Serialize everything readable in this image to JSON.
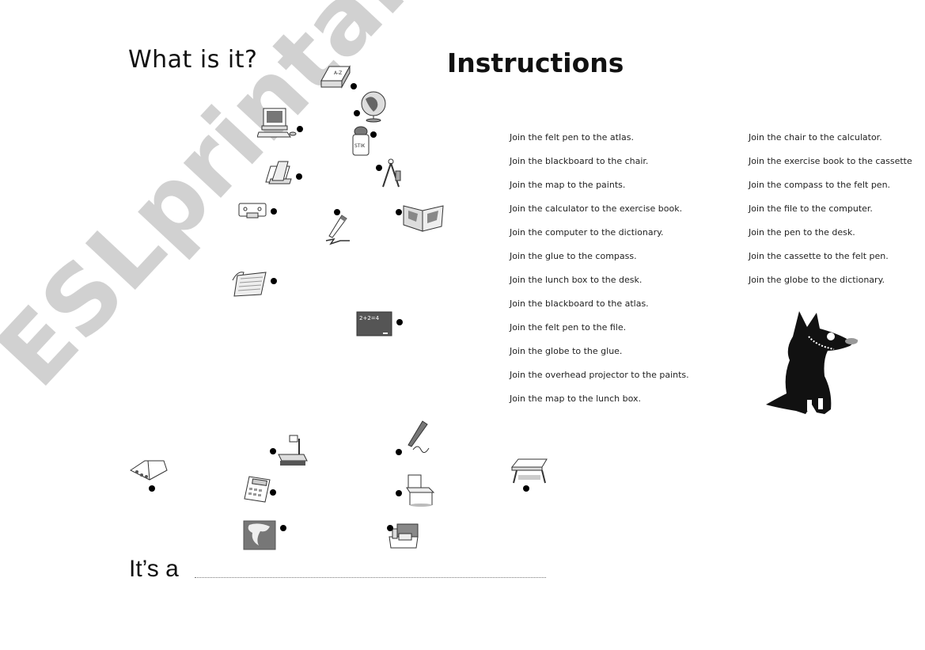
{
  "header": {
    "question_title": "What is it?",
    "instructions_title": "Instructions"
  },
  "instructions": {
    "column1": [
      "Join the felt pen to the atlas.",
      "Join the blackboard to the chair.",
      "Join  the map to the paints.",
      "Join the calculator to the exercise book.",
      "Join the computer to the dictionary.",
      "Join the glue to the compass.",
      "Join the lunch box to the desk.",
      "Join the blackboard to the atlas.",
      "Join the felt pen to the file.",
      "Join the globe to the glue.",
      "Join the overhead projector to the paints.",
      "Join the map to the lunch box."
    ],
    "column2": [
      "Join the chair to the calculator.",
      "Join the exercise book to the cassette",
      "Join the compass to the felt pen.",
      "Join the file to the computer.",
      "Join the pen to the desk.",
      "Join the cassette to the felt pen.",
      "Join the globe to the dictionary."
    ]
  },
  "pictures": [
    {
      "name": "dictionary",
      "label": "A-Z"
    },
    {
      "name": "globe"
    },
    {
      "name": "computer"
    },
    {
      "name": "glue",
      "label": "STIK"
    },
    {
      "name": "file"
    },
    {
      "name": "compass"
    },
    {
      "name": "cassette"
    },
    {
      "name": "felt pen"
    },
    {
      "name": "atlas"
    },
    {
      "name": "exercise book"
    },
    {
      "name": "blackboard",
      "label": "2+2=4"
    },
    {
      "name": "overhead projector"
    },
    {
      "name": "pen"
    },
    {
      "name": "paints"
    },
    {
      "name": "calculator"
    },
    {
      "name": "chair"
    },
    {
      "name": "desk"
    },
    {
      "name": "map"
    },
    {
      "name": "lunch box"
    }
  ],
  "answer": {
    "prefix": "It’s a"
  },
  "watermark": "ESLprintables.com"
}
